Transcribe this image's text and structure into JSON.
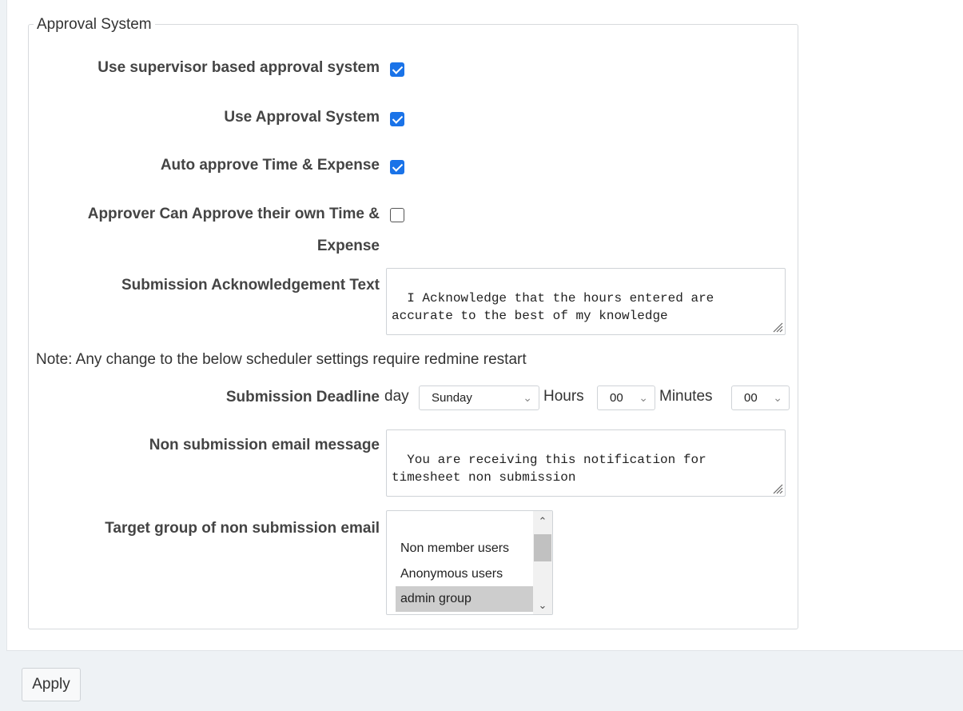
{
  "fieldset": {
    "legend": "Approval System",
    "supervisor_label": "Use supervisor based approval system",
    "supervisor_checked": true,
    "approval_label": "Use Approval System",
    "approval_checked": true,
    "auto_approve_label": "Auto approve Time & Expense",
    "auto_approve_checked": true,
    "own_approve_label_line1": "Approver Can Approve their own Time &",
    "own_approve_label_line2": "Expense",
    "own_approve_checked": false,
    "ack_label": "Submission Acknowledgement Text",
    "ack_text": "I Acknowledge that the hours entered are\naccurate to the best of my knowledge",
    "note": "Note: Any change to the below scheduler settings require redmine restart",
    "deadline_label": "Submission Deadline",
    "day_label": "day",
    "day_value": "Sunday",
    "hours_label": "Hours",
    "hours_value": "00",
    "minutes_label": "Minutes",
    "minutes_value": "00",
    "email_label": "Non submission email message",
    "email_text": "You are receiving this notification for\ntimesheet non submission",
    "target_label": "Target group of non submission email",
    "target_options": [
      {
        "label": "Non member users",
        "selected": false
      },
      {
        "label": "Anonymous users",
        "selected": false
      },
      {
        "label": "admin group",
        "selected": true
      }
    ]
  },
  "actions": {
    "apply_label": "Apply"
  },
  "colors": {
    "checkbox_accent": "#1a73e8",
    "page_background": "#eef2f5",
    "selected_option": "#cdcdcd"
  }
}
